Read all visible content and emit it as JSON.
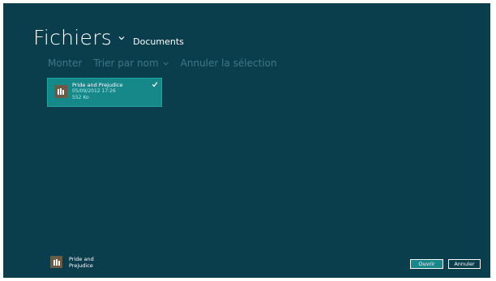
{
  "header": {
    "title": "Fichiers",
    "location": "Documents"
  },
  "commands": {
    "up": "Monter",
    "sort": "Trier par nom",
    "clear": "Annuler la sélection"
  },
  "files": [
    {
      "name": "Pride and Prejudice",
      "date": "05/09/2012 17:26",
      "size": "552 Ko",
      "selected": true,
      "icon": "book-icon"
    }
  ],
  "basket": {
    "line1": "Pride and",
    "line2": "Prejudice",
    "icon": "book-icon"
  },
  "buttons": {
    "open": "Ouvrir",
    "cancel": "Annuler"
  },
  "colors": {
    "background": "#0a3e4d",
    "accent": "#17888a",
    "dim_text": "#3f7886"
  }
}
